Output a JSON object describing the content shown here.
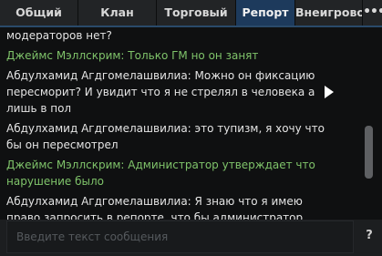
{
  "tabs": [
    {
      "label": "Общий",
      "active": false
    },
    {
      "label": "Клан",
      "active": false
    },
    {
      "label": "Торговый",
      "active": false
    },
    {
      "label": "Репорт",
      "active": true
    },
    {
      "label": "Внеигровой",
      "active": false
    }
  ],
  "tabs_more_label": "•••",
  "messages": [
    {
      "lines": [
        "модераторов нет?"
      ],
      "color": "white"
    },
    {
      "lines": [
        "Джеймс Мэллскрим: Только ГМ но он занят"
      ],
      "color": "green"
    },
    {
      "lines": [
        "Абдулхамид Агдгомелашвилиа: Можно он фиксацию",
        "пересморит? И увидит что я не стрелял в человека а",
        "лишь в пол"
      ],
      "color": "white"
    },
    {
      "lines": [
        "Абдулхамид Агдгомелашвилиа: это тупизм, я хочу что",
        "бы он пересмотрел"
      ],
      "color": "white"
    },
    {
      "lines": [
        "Джеймс Мэллскрим: Администратор утверждает что",
        "нарушение было"
      ],
      "color": "green"
    },
    {
      "lines": [
        "Абдулхамид Агдгомелашвилиа: Я знаю что я имею",
        "право запросить в репорте, что бы администратор"
      ],
      "color": "white"
    }
  ],
  "input": {
    "placeholder": "Введите текст сообщения",
    "value": ""
  },
  "help_label": "?",
  "colors": {
    "green": "#7fc36a",
    "white": "#e4e4e4",
    "active_tab": "#1d3a5c"
  }
}
